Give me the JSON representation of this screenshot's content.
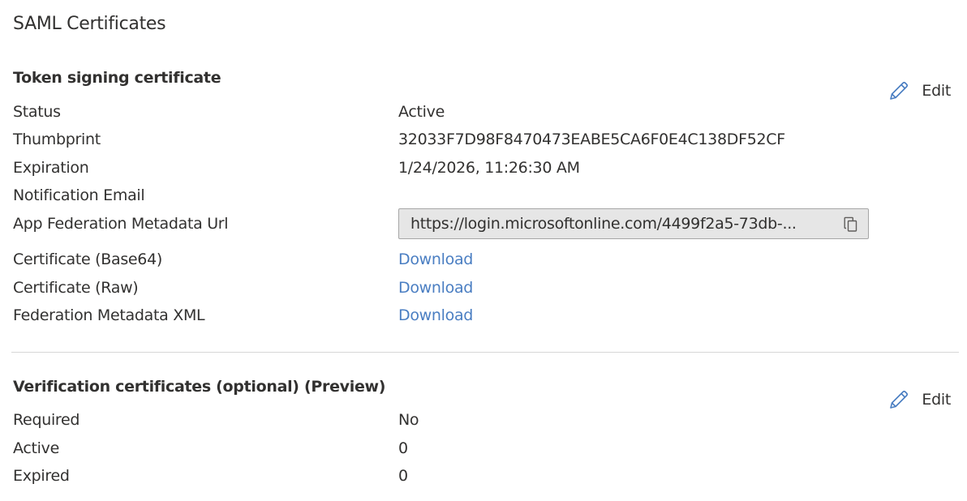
{
  "page": {
    "title": "SAML Certificates"
  },
  "token_signing": {
    "title": "Token signing certificate",
    "edit_label": "Edit",
    "rows": {
      "status": {
        "label": "Status",
        "value": "Active"
      },
      "thumbprint": {
        "label": "Thumbprint",
        "value": "32033F7D98F8470473EABE5CA6F0E4C138DF52CF"
      },
      "expiration": {
        "label": "Expiration",
        "value": "1/24/2026, 11:26:30 AM"
      },
      "notification_email": {
        "label": "Notification Email",
        "value": ""
      },
      "metadata_url": {
        "label": "App Federation Metadata Url",
        "value": "https://login.microsoftonline.com/4499f2a5-73db-..."
      },
      "cert_base64": {
        "label": "Certificate (Base64)",
        "value": "Download"
      },
      "cert_raw": {
        "label": "Certificate (Raw)",
        "value": "Download"
      },
      "federation_xml": {
        "label": "Federation Metadata XML",
        "value": "Download"
      }
    }
  },
  "verification": {
    "title": "Verification certificates (optional) (Preview)",
    "edit_label": "Edit",
    "rows": {
      "required": {
        "label": "Required",
        "value": "No"
      },
      "active": {
        "label": "Active",
        "value": "0"
      },
      "expired": {
        "label": "Expired",
        "value": "0"
      }
    }
  },
  "icons": {
    "edit": "pencil-icon",
    "copy": "copy-icon"
  },
  "colors": {
    "link": "#4a7ec2",
    "icon_accent": "#4a7ec2",
    "text": "#323130",
    "field_bg": "#e6e6e6",
    "divider": "#d6d6d6"
  }
}
